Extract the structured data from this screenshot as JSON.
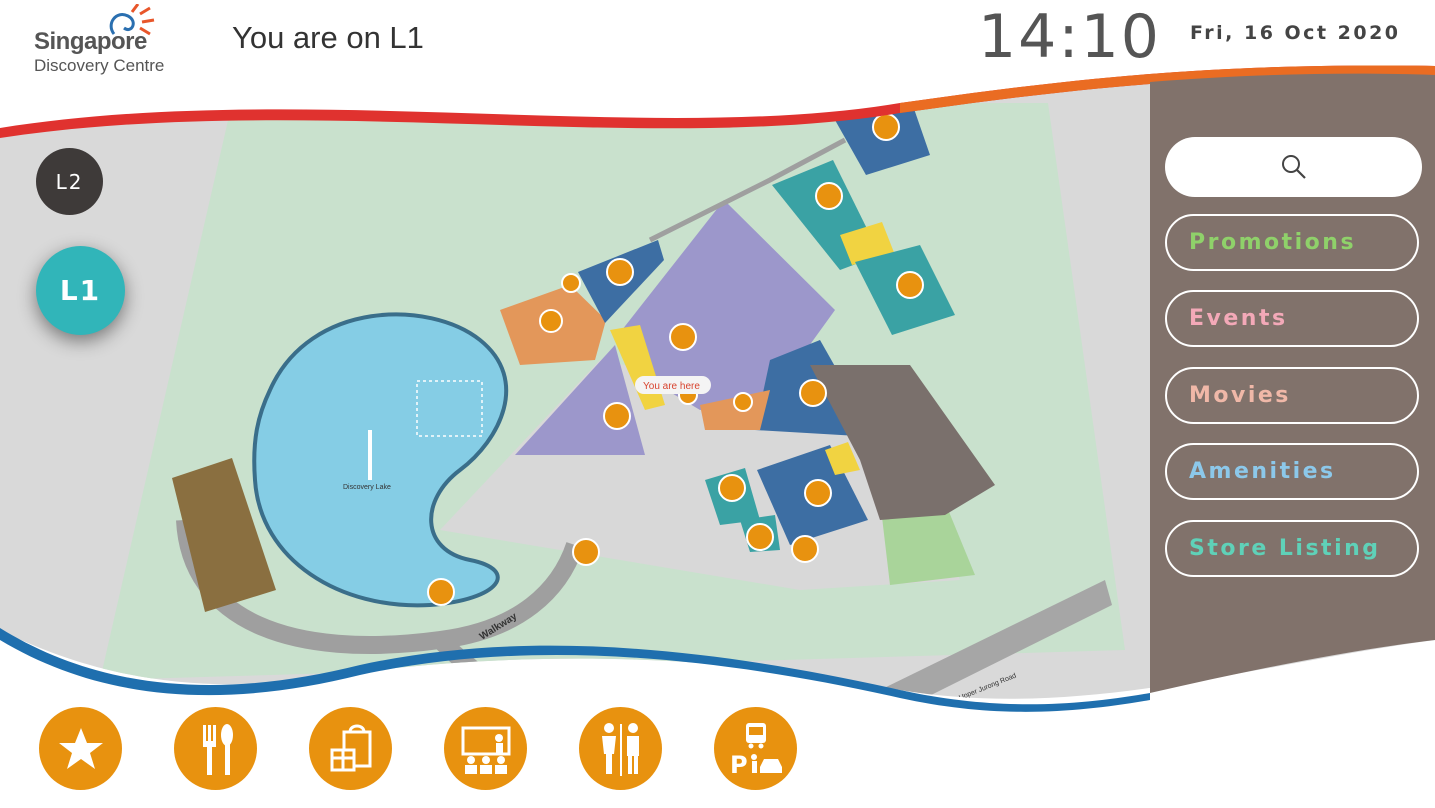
{
  "header": {
    "logo_line1": "Singapore",
    "logo_line2": "Discovery Centre",
    "location": "You are on L1",
    "time": "14:10",
    "date": "Fri, 16 Oct 2020"
  },
  "floors": [
    {
      "label": "L2",
      "active": false
    },
    {
      "label": "L1",
      "active": true
    }
  ],
  "map": {
    "you_are_here": "You are here",
    "lake_label": "Discovery Lake",
    "walkway_label": "Walkway",
    "road_label": "Upper Jurong Road"
  },
  "menu": [
    {
      "label": "Promotions",
      "color": "#8fd16a"
    },
    {
      "label": "Events",
      "color": "#f3a9b8"
    },
    {
      "label": "Movies",
      "color": "#f0b8a8"
    },
    {
      "label": "Amenities",
      "color": "#8cc8ea"
    },
    {
      "label": "Store Listing",
      "color": "#5fd1b8"
    }
  ],
  "categories": [
    {
      "icon": "star-icon"
    },
    {
      "icon": "dining-icon"
    },
    {
      "icon": "shopping-icon"
    },
    {
      "icon": "classroom-icon"
    },
    {
      "icon": "restroom-icon"
    },
    {
      "icon": "transport-icon"
    }
  ],
  "colors": {
    "accent_orange": "#e8920f",
    "panel": "#81726b",
    "floor_active": "#31b5b9",
    "floor_inactive": "#3e3a39"
  }
}
